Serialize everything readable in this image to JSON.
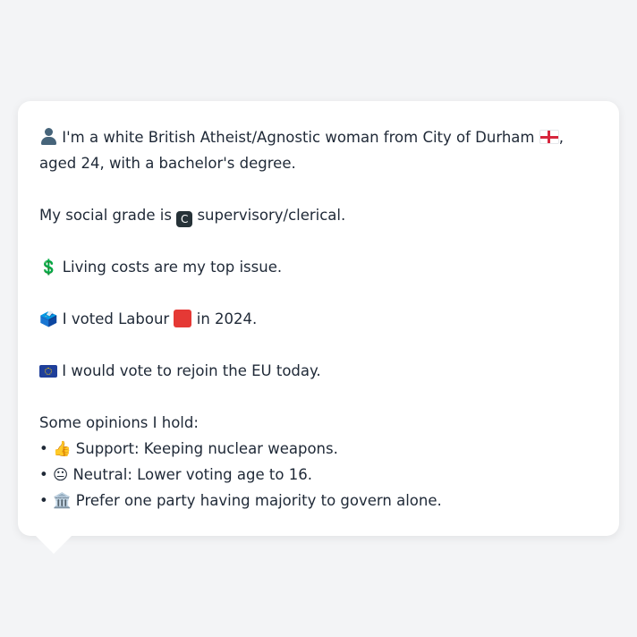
{
  "profile": {
    "intro_text": "I'm a white British Atheist/Agnostic woman from City of Durham",
    "intro_rest": ", aged 24, with a bachelor's degree.",
    "social_grade_prefix": "My social grade is",
    "social_grade_badge": "C",
    "social_grade_suffix": "supervisory/clerical.",
    "top_issue_icon": "💲",
    "top_issue": "Living costs are my top issue.",
    "ballot_icon": "🗳️",
    "vote_prefix": "I voted Labour",
    "vote_suffix": "in 2024.",
    "eu_text": "I would vote to rejoin the EU today.",
    "opinions_heading": "Some opinions I hold:",
    "opinions": [
      {
        "bullet": "•",
        "emoji": "👍",
        "text": "Support: Keeping nuclear weapons."
      },
      {
        "bullet": "•",
        "emoji": "😐",
        "text": "Neutral: Lower voting age to 16."
      },
      {
        "bullet": "•",
        "emoji": "🏛️",
        "text": "Prefer one party having majority to govern alone."
      }
    ]
  },
  "icons": {
    "person": "person-silhouette-icon",
    "england_flag": "england-flag-icon",
    "grade_badge": "c-badge-icon",
    "dollar": "dollar-icon",
    "ballot": "ballot-box-icon",
    "labour_square": "red-square-icon",
    "eu_flag": "eu-flag-icon"
  },
  "colors": {
    "background": "#f3f4f6",
    "bubble": "#ffffff",
    "text": "#1f2937",
    "labour_red": "#e53935"
  }
}
